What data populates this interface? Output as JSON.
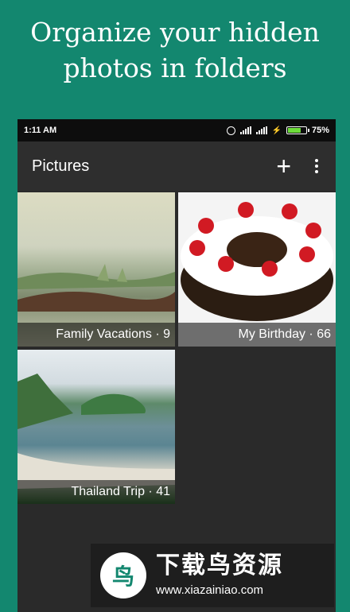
{
  "headline": {
    "line1": "Organize your hidden",
    "line2": "photos in folders"
  },
  "status_bar": {
    "time": "1:11 AM",
    "battery": "75%",
    "battery_level": 0.75,
    "icons": [
      "alarm-icon",
      "signal-icon",
      "signal-icon",
      "charging-icon",
      "battery-icon"
    ]
  },
  "app_bar": {
    "title": "Pictures",
    "add_icon": "plus-icon",
    "menu_icon": "more-vert-icon"
  },
  "folders": [
    {
      "name": "Family Vacations",
      "count": 9,
      "caption": "Family Vacations · 9"
    },
    {
      "name": "My Birthday",
      "count": 66,
      "caption": "My Birthday · 66"
    },
    {
      "name": "Thailand Trip",
      "count": 41,
      "caption": "Thailand Trip · 41"
    }
  ],
  "watermark": {
    "name": "下载鸟资源",
    "url": "www.xiazainiao.com"
  },
  "colors": {
    "background": "#13876f",
    "app_bar": "#2e2e2e",
    "status_bar": "#0d0d0d",
    "battery_fill": "#6ddc3a"
  }
}
